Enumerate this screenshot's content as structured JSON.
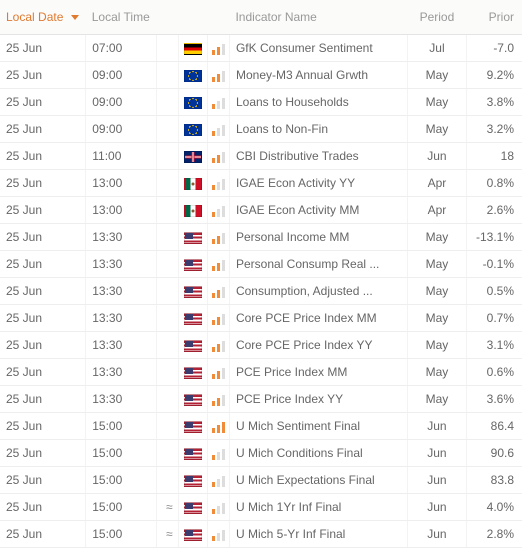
{
  "columns": {
    "date": "Local Date",
    "time": "Local Time",
    "name": "Indicator Name",
    "period": "Period",
    "prior": "Prior"
  },
  "rows": [
    {
      "date": "25 Jun",
      "time": "07:00",
      "approx": false,
      "flag": "de",
      "importance": 2,
      "name": "GfK Consumer Sentiment",
      "period": "Jul",
      "prior": "-7.0"
    },
    {
      "date": "25 Jun",
      "time": "09:00",
      "approx": false,
      "flag": "eu",
      "importance": 2,
      "name": "Money-M3 Annual Grwth",
      "period": "May",
      "prior": "9.2%"
    },
    {
      "date": "25 Jun",
      "time": "09:00",
      "approx": false,
      "flag": "eu",
      "importance": 1,
      "name": "Loans to Households",
      "period": "May",
      "prior": "3.8%"
    },
    {
      "date": "25 Jun",
      "time": "09:00",
      "approx": false,
      "flag": "eu",
      "importance": 1,
      "name": "Loans to Non-Fin",
      "period": "May",
      "prior": "3.2%"
    },
    {
      "date": "25 Jun",
      "time": "11:00",
      "approx": false,
      "flag": "gb",
      "importance": 2,
      "name": "CBI Distributive Trades",
      "period": "Jun",
      "prior": "18"
    },
    {
      "date": "25 Jun",
      "time": "13:00",
      "approx": false,
      "flag": "mx",
      "importance": 1,
      "name": "IGAE Econ Activity YY",
      "period": "Apr",
      "prior": "0.8%"
    },
    {
      "date": "25 Jun",
      "time": "13:00",
      "approx": false,
      "flag": "mx",
      "importance": 1,
      "name": "IGAE Econ Activity MM",
      "period": "Apr",
      "prior": "2.6%"
    },
    {
      "date": "25 Jun",
      "time": "13:30",
      "approx": false,
      "flag": "us",
      "importance": 2,
      "name": "Personal Income MM",
      "period": "May",
      "prior": "-13.1%"
    },
    {
      "date": "25 Jun",
      "time": "13:30",
      "approx": false,
      "flag": "us",
      "importance": 2,
      "name": "Personal Consump Real ...",
      "period": "May",
      "prior": "-0.1%"
    },
    {
      "date": "25 Jun",
      "time": "13:30",
      "approx": false,
      "flag": "us",
      "importance": 2,
      "name": "Consumption, Adjusted ...",
      "period": "May",
      "prior": "0.5%"
    },
    {
      "date": "25 Jun",
      "time": "13:30",
      "approx": false,
      "flag": "us",
      "importance": 2,
      "name": "Core PCE Price Index MM",
      "period": "May",
      "prior": "0.7%"
    },
    {
      "date": "25 Jun",
      "time": "13:30",
      "approx": false,
      "flag": "us",
      "importance": 2,
      "name": "Core PCE Price Index YY",
      "period": "May",
      "prior": "3.1%"
    },
    {
      "date": "25 Jun",
      "time": "13:30",
      "approx": false,
      "flag": "us",
      "importance": 2,
      "name": "PCE Price Index MM",
      "period": "May",
      "prior": "0.6%"
    },
    {
      "date": "25 Jun",
      "time": "13:30",
      "approx": false,
      "flag": "us",
      "importance": 2,
      "name": "PCE Price Index YY",
      "period": "May",
      "prior": "3.6%"
    },
    {
      "date": "25 Jun",
      "time": "15:00",
      "approx": false,
      "flag": "us",
      "importance": 3,
      "name": "U Mich Sentiment Final",
      "period": "Jun",
      "prior": "86.4"
    },
    {
      "date": "25 Jun",
      "time": "15:00",
      "approx": false,
      "flag": "us",
      "importance": 1,
      "name": "U Mich Conditions Final",
      "period": "Jun",
      "prior": "90.6"
    },
    {
      "date": "25 Jun",
      "time": "15:00",
      "approx": false,
      "flag": "us",
      "importance": 1,
      "name": "U Mich Expectations Final",
      "period": "Jun",
      "prior": "83.8"
    },
    {
      "date": "25 Jun",
      "time": "15:00",
      "approx": true,
      "flag": "us",
      "importance": 1,
      "name": "U Mich 1Yr Inf Final",
      "period": "Jun",
      "prior": "4.0%"
    },
    {
      "date": "25 Jun",
      "time": "15:00",
      "approx": true,
      "flag": "us",
      "importance": 1,
      "name": "U Mich 5-Yr Inf Final",
      "period": "Jun",
      "prior": "2.8%"
    }
  ]
}
